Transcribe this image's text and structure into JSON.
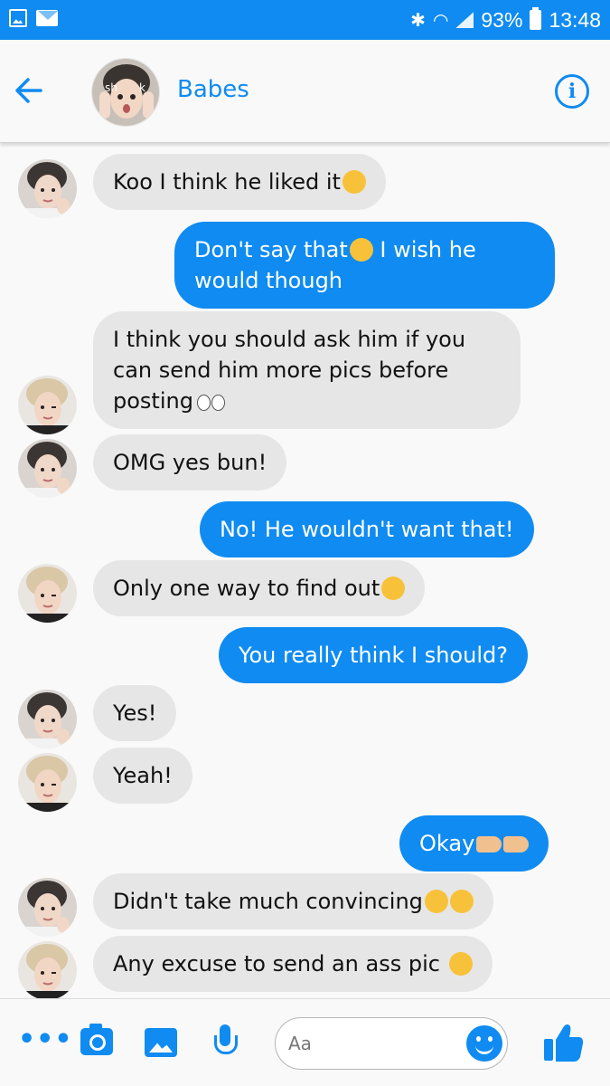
{
  "status_bar": {
    "battery": "93%",
    "time": "13:48"
  },
  "header": {
    "contact_name": "Babes",
    "avatar_text": "sh ok"
  },
  "messages": [
    {
      "side": "in",
      "text": "Koo I think he liked it",
      "emoji": "smirk-emoji"
    },
    {
      "side": "out",
      "text": "Don't say that",
      "emoji": "worried-emoji",
      "text2": " I wish he would though"
    },
    {
      "side": "in",
      "text": "I think you should ask him if you can send him more pics before posting",
      "emoji": "eyes-emoji"
    },
    {
      "side": "in",
      "text": "OMG yes bun!"
    },
    {
      "side": "out",
      "text": "No! He wouldn't want that!"
    },
    {
      "side": "in",
      "text": "Only one way to find out",
      "emoji": "sunglasses-emoji"
    },
    {
      "side": "out",
      "text": "You really think I should?"
    },
    {
      "side": "in",
      "text": "Yes!"
    },
    {
      "side": "in",
      "text": "Yeah!"
    },
    {
      "side": "out",
      "text": "Okay",
      "emoji": "pointing-hands-emoji"
    },
    {
      "side": "in",
      "text": "Didn't take much convincing",
      "emoji": "laughing-tears-emoji"
    },
    {
      "side": "in",
      "text": "Any excuse to send an ass pic ",
      "emoji": "wink-emoji"
    }
  ],
  "composer": {
    "placeholder": "Aa"
  },
  "colors": {
    "brand_blue": "#0f8bf1",
    "incoming_bubble": "#e6e6e6",
    "background": "#f9f9f9"
  }
}
